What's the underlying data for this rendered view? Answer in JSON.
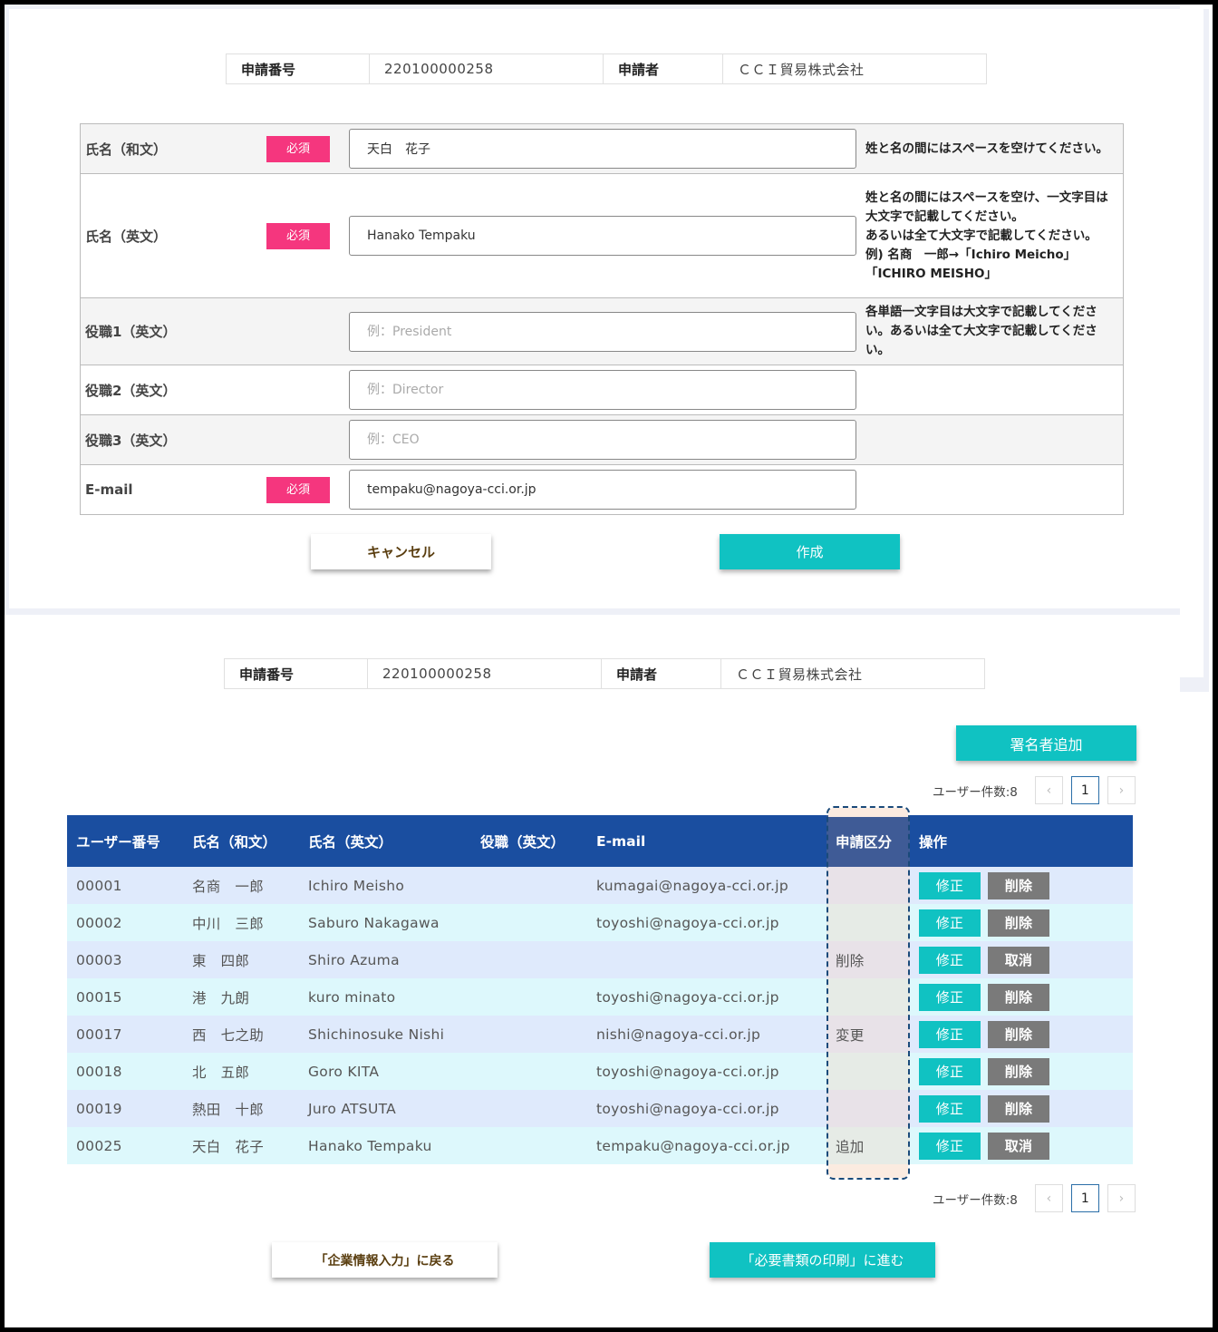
{
  "application": {
    "label_number": "申請番号",
    "number": "220100000258",
    "label_applicant": "申請者",
    "applicant": "ＣＣＩ貿易株式会社"
  },
  "form": {
    "required_label": "必須",
    "fields": [
      {
        "label": "氏名（和文）",
        "required": true,
        "value": "天白　花子",
        "placeholder": "",
        "hint": "姓と名の間にはスペースを空けてください。"
      },
      {
        "label": "氏名（英文）",
        "required": true,
        "value": "Hanako Tempaku",
        "placeholder": "",
        "hint_lines": [
          "姓と名の間にはスペースを空け、一文字目は大文字で記載してください。",
          "あるいは全て大文字で記載してください。",
          "例) 名商　一郎→「Ichiro Meicho」「ICHIRO MEISHO」"
        ]
      },
      {
        "label": "役職1（英文）",
        "required": false,
        "value": "",
        "placeholder": "例：President",
        "hint": "各単語一文字目は大文字で記載してください。あるいは全て大文字で記載してください。"
      },
      {
        "label": "役職2（英文）",
        "required": false,
        "value": "",
        "placeholder": "例：Director",
        "hint": ""
      },
      {
        "label": "役職3（英文）",
        "required": false,
        "value": "",
        "placeholder": "例：CEO",
        "hint": ""
      },
      {
        "label": "E-mail",
        "required": true,
        "value": "tempaku@nagoya-cci.or.jp",
        "placeholder": "",
        "hint": ""
      }
    ],
    "cancel_label": "キャンセル",
    "create_label": "作成"
  },
  "list": {
    "add_signer_label": "署名者追加",
    "user_count_label": "ユーザー件数:8",
    "prev_icon": "‹",
    "next_icon": "›",
    "current_page": "1",
    "columns": [
      "ユーザー番号",
      "氏名（和文）",
      "氏名（英文）",
      "役職（英文）",
      "E-mail",
      "申請区分",
      "操作"
    ],
    "edit_label": "修正",
    "rows": [
      {
        "id": "00001",
        "name_ja": "名商　一郎",
        "name_en": "Ichiro Meisho",
        "title": "",
        "email": "kumagai@nagoya-cci.or.jp",
        "kubun": "",
        "action": "削除"
      },
      {
        "id": "00002",
        "name_ja": "中川　三郎",
        "name_en": "Saburo Nakagawa",
        "title": "",
        "email": "toyoshi@nagoya-cci.or.jp",
        "kubun": "",
        "action": "削除"
      },
      {
        "id": "00003",
        "name_ja": "東　四郎",
        "name_en": "Shiro Azuma",
        "title": "",
        "email": "",
        "kubun": "削除",
        "action": "取消"
      },
      {
        "id": "00015",
        "name_ja": "港　九朗",
        "name_en": "kuro minato",
        "title": "",
        "email": "toyoshi@nagoya-cci.or.jp",
        "kubun": "",
        "action": "削除"
      },
      {
        "id": "00017",
        "name_ja": "西　七之助",
        "name_en": "Shichinosuke Nishi",
        "title": "",
        "email": "nishi@nagoya-cci.or.jp",
        "kubun": "変更",
        "action": "削除"
      },
      {
        "id": "00018",
        "name_ja": "北　五郎",
        "name_en": "Goro KITA",
        "title": "",
        "email": "toyoshi@nagoya-cci.or.jp",
        "kubun": "",
        "action": "削除"
      },
      {
        "id": "00019",
        "name_ja": "熱田　十郎",
        "name_en": "Juro ATSUTA",
        "title": "",
        "email": "toyoshi@nagoya-cci.or.jp",
        "kubun": "",
        "action": "削除"
      },
      {
        "id": "00025",
        "name_ja": "天白　花子",
        "name_en": "Hanako Tempaku",
        "title": "",
        "email": "tempaku@nagoya-cci.or.jp",
        "kubun": "追加",
        "action": "取消"
      }
    ],
    "back_label": "「企業情報入力」に戻る",
    "next_label": "「必要書類の印刷」に進む"
  },
  "colors": {
    "required_badge": "#f5367e",
    "primary_teal": "#10c2c2",
    "header_blue": "#1a4ea0",
    "action_gray": "#7a7a7a"
  }
}
